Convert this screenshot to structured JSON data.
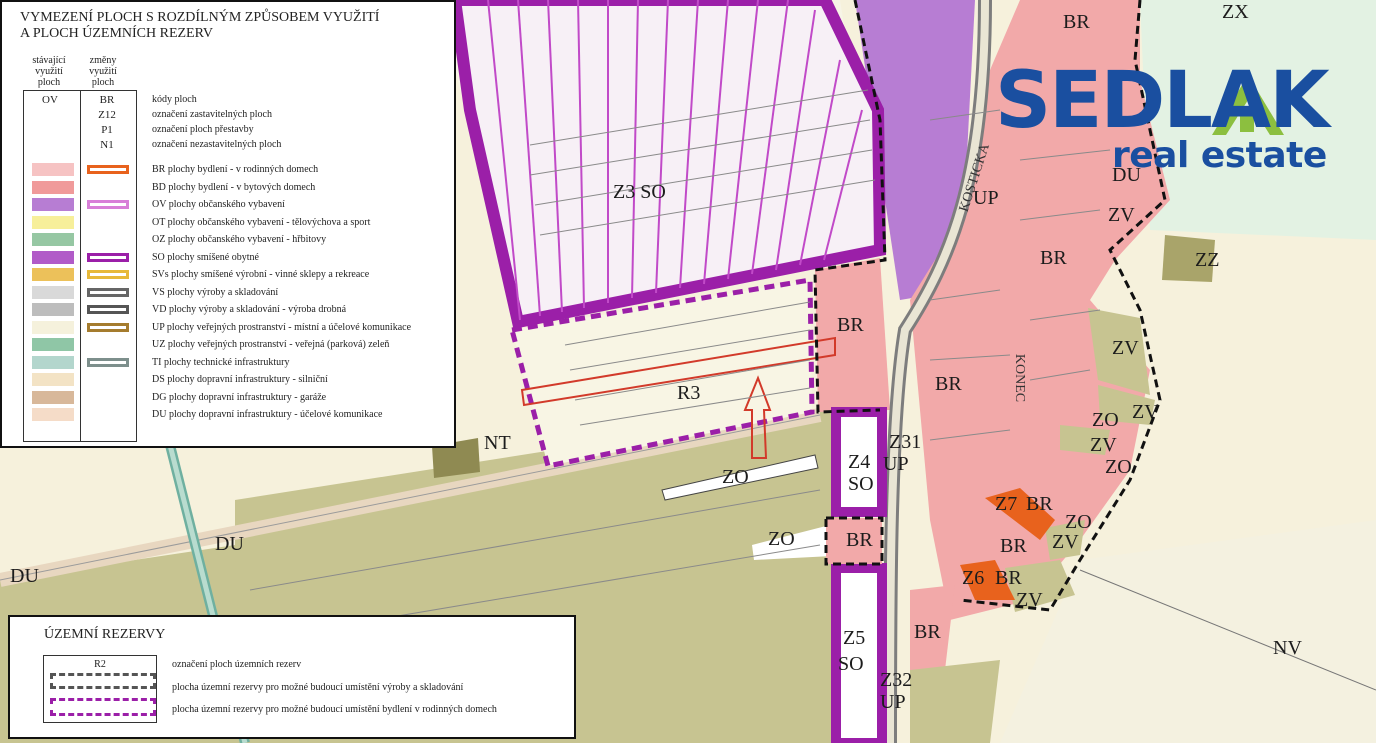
{
  "colors": {
    "background": "#f6f1dc",
    "housing_br": "#f2a9a9",
    "civic_ov": "#b77dd3",
    "mixed_so": "#9b1fa8",
    "green_zv": "#c7c491",
    "public_up": "#f5efdd",
    "road": "#9a9a9a",
    "logo_blue": "#1a4fa0",
    "logo_green": "#8cbf3f"
  },
  "legend_main": {
    "title_line1": "VYMEZENÍ PLOCH S ROZDÍLNÝM ZPŮSOBEM VYUŽITÍ",
    "title_line2": "A PLOCH ÚZEMNÍCH REZERV",
    "col_existing": [
      "stávající",
      "využití",
      "ploch"
    ],
    "col_changes": [
      "změny",
      "využití",
      "ploch"
    ],
    "code_examples": [
      {
        "left": "OV",
        "right": "BR",
        "desc": "kódy ploch"
      },
      {
        "left": "",
        "right": "Z12",
        "desc": "označení zastavitelných ploch"
      },
      {
        "left": "",
        "right": "P1",
        "desc": "označení ploch přestavby"
      },
      {
        "left": "",
        "right": "N1",
        "desc": "označení nezastavitelných ploch"
      }
    ],
    "items": [
      {
        "desc": "BR plochy bydlení - v rodinných domech",
        "swatch": "#f6c3c3",
        "change": "#e8621d"
      },
      {
        "desc": "BD plochy bydlení - v bytových domech",
        "swatch": "#f09a9a",
        "change": ""
      },
      {
        "desc": "OV plochy občanského vybavení",
        "swatch": "#b77dd3",
        "change": "#d87fd8"
      },
      {
        "desc": "OT plochy občanského vybavení - tělovýchova a sport",
        "swatch": "#f7ef9a",
        "change": ""
      },
      {
        "desc": "OZ plochy občanského vybavení - hřbitovy",
        "swatch": "#96c7a3",
        "change": ""
      },
      {
        "desc": "SO plochy smíšené obytné",
        "swatch": "#b15bc8",
        "change": "#9b1fa8"
      },
      {
        "desc": "SVs  plochy smíšené výrobní - vinné sklepy a rekreace",
        "swatch": "#ecc15a",
        "change": "#e7b93a"
      },
      {
        "desc": "VS plochy výroby a skladování",
        "swatch": "#d9d9d9",
        "change": "#666666"
      },
      {
        "desc": "VD plochy výroby a skladování - výroba drobná",
        "swatch": "#bdbdbd",
        "change": "#555555"
      },
      {
        "desc": "UP plochy veřejných prostranství - místní a účelové komunikace",
        "swatch": "#f5f1dc",
        "change": "#a57c2e"
      },
      {
        "desc": "UZ plochy veřejných prostranství - veřejná (parková) zeleň",
        "swatch": "#8fc6a6",
        "change": ""
      },
      {
        "desc": "TI  plochy technické infrastruktury",
        "swatch": "#b3d6cd",
        "change": "#7d8f8c"
      },
      {
        "desc": "DS plochy dopravní infrastruktury - silniční",
        "swatch": "#f3e3c5",
        "change": ""
      },
      {
        "desc": "DG plochy dopravní infrastruktury - garáže",
        "swatch": "#d8b89a",
        "change": ""
      },
      {
        "desc": "DU plochy dopravní infrastruktury - účelové komunikace",
        "swatch": "#f5dcc8",
        "change": ""
      }
    ]
  },
  "legend_reserves": {
    "title": "ÚZEMNÍ REZERVY",
    "items": [
      {
        "sample": "R2",
        "desc": "označení ploch územních rezerv"
      },
      {
        "sample": "",
        "desc": "plocha územní rezervy pro možné budoucí umístění výroby a skladování"
      },
      {
        "sample": "",
        "desc": "plocha územní rezervy pro možné budoucí umístění bydlení v rodinných domech"
      }
    ]
  },
  "logo": {
    "brand": "SEDLAK",
    "tagline": "real estate"
  },
  "map_labels": [
    {
      "id": "br-top",
      "text": "BR"
    },
    {
      "id": "zx-top",
      "text": "ZX"
    },
    {
      "id": "z3so",
      "text": "Z3 SO"
    },
    {
      "id": "up-kosticka",
      "text": "UP"
    },
    {
      "id": "du-right",
      "text": "DU"
    },
    {
      "id": "zv-1",
      "text": "ZV"
    },
    {
      "id": "br-east",
      "text": "BR"
    },
    {
      "id": "zz",
      "text": "ZZ"
    },
    {
      "id": "br-mid",
      "text": "BR"
    },
    {
      "id": "r3",
      "text": "R3"
    },
    {
      "id": "br-konec",
      "text": "BR"
    },
    {
      "id": "zv-2",
      "text": "ZV"
    },
    {
      "id": "zo-1",
      "text": "ZO"
    },
    {
      "id": "zv-3",
      "text": "ZV"
    },
    {
      "id": "zv-4",
      "text": "ZV"
    },
    {
      "id": "zo-2",
      "text": "ZO"
    },
    {
      "id": "nt",
      "text": "NT"
    },
    {
      "id": "z31",
      "text": "Z31"
    },
    {
      "id": "z4",
      "text": "Z4"
    },
    {
      "id": "up-z4",
      "text": "UP"
    },
    {
      "id": "so-z4",
      "text": "SO"
    },
    {
      "id": "zo-road",
      "text": "ZO"
    },
    {
      "id": "z7",
      "text": "Z7"
    },
    {
      "id": "br-z7",
      "text": "BR"
    },
    {
      "id": "zo-3",
      "text": "ZO"
    },
    {
      "id": "zo-4",
      "text": "ZO"
    },
    {
      "id": "br-lower",
      "text": "BR"
    },
    {
      "id": "br-south",
      "text": "BR"
    },
    {
      "id": "zv-5",
      "text": "ZV"
    },
    {
      "id": "z6",
      "text": "Z6"
    },
    {
      "id": "br-z6",
      "text": "BR"
    },
    {
      "id": "zv-6",
      "text": "ZV"
    },
    {
      "id": "du-mid",
      "text": "DU"
    },
    {
      "id": "du-left",
      "text": "DU"
    },
    {
      "id": "br-bottom",
      "text": "BR"
    },
    {
      "id": "z5",
      "text": "Z5"
    },
    {
      "id": "so-z5",
      "text": "SO"
    },
    {
      "id": "nv",
      "text": "NV"
    },
    {
      "id": "z32",
      "text": "Z32"
    },
    {
      "id": "up-z32",
      "text": "UP"
    }
  ],
  "streets": [
    {
      "id": "kosticka",
      "text": "KOSTICKA"
    },
    {
      "id": "konec",
      "text": "KONEC"
    }
  ]
}
